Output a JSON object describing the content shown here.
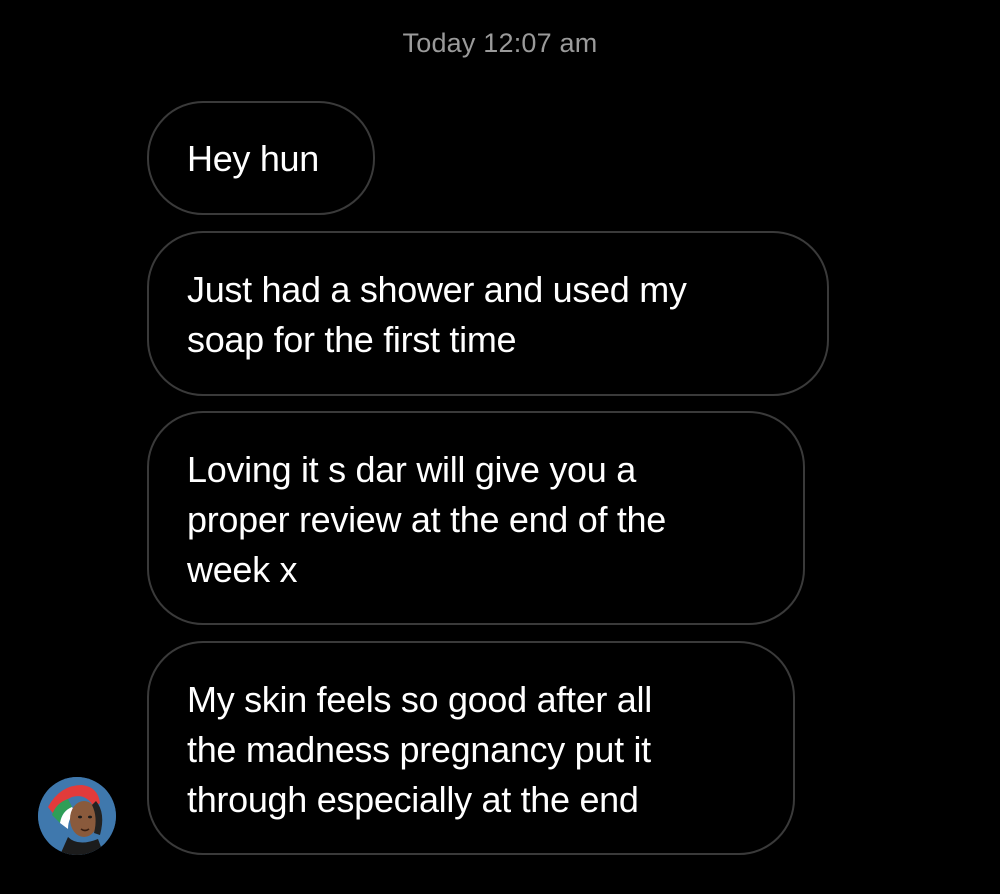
{
  "header": {
    "timestamp": "Today 12:07 am"
  },
  "messages": [
    {
      "text": "Hey hun"
    },
    {
      "text": "Just had a shower and used my\nsoap for the first time"
    },
    {
      "text": "Loving it s dar will give you a\nproper review at the end of the\nweek x"
    },
    {
      "text": "My skin feels so good after all\nthe madness pregnancy put it\nthrough especially at the end"
    }
  ],
  "sender": {
    "avatar_icon": "profile-avatar-icon"
  },
  "colors": {
    "background": "#000000",
    "bubble_border": "#3a3a3a",
    "timestamp_text": "#9a9a9a",
    "message_text": "#ffffff"
  }
}
